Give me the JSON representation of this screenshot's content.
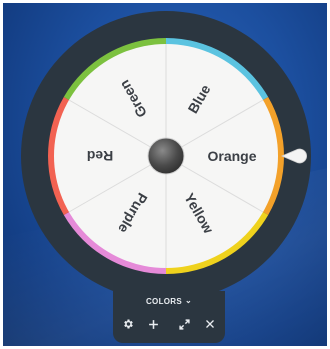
{
  "wheel": {
    "segments": [
      {
        "label": "Blue",
        "color": "#5bc3e0"
      },
      {
        "label": "Orange",
        "color": "#f3a12a"
      },
      {
        "label": "Yellow",
        "color": "#efd21d"
      },
      {
        "label": "Purple",
        "color": "#e58ad8"
      },
      {
        "label": "Red",
        "color": "#f26252"
      },
      {
        "label": "Green",
        "color": "#7cc13f"
      }
    ],
    "frame_color": "#2b3640",
    "face_color": "#f6f6f5"
  },
  "toolbar": {
    "colors_label": "COLORS",
    "icons": [
      "gear-icon",
      "plus-icon",
      "expand-icon",
      "close-icon"
    ]
  }
}
